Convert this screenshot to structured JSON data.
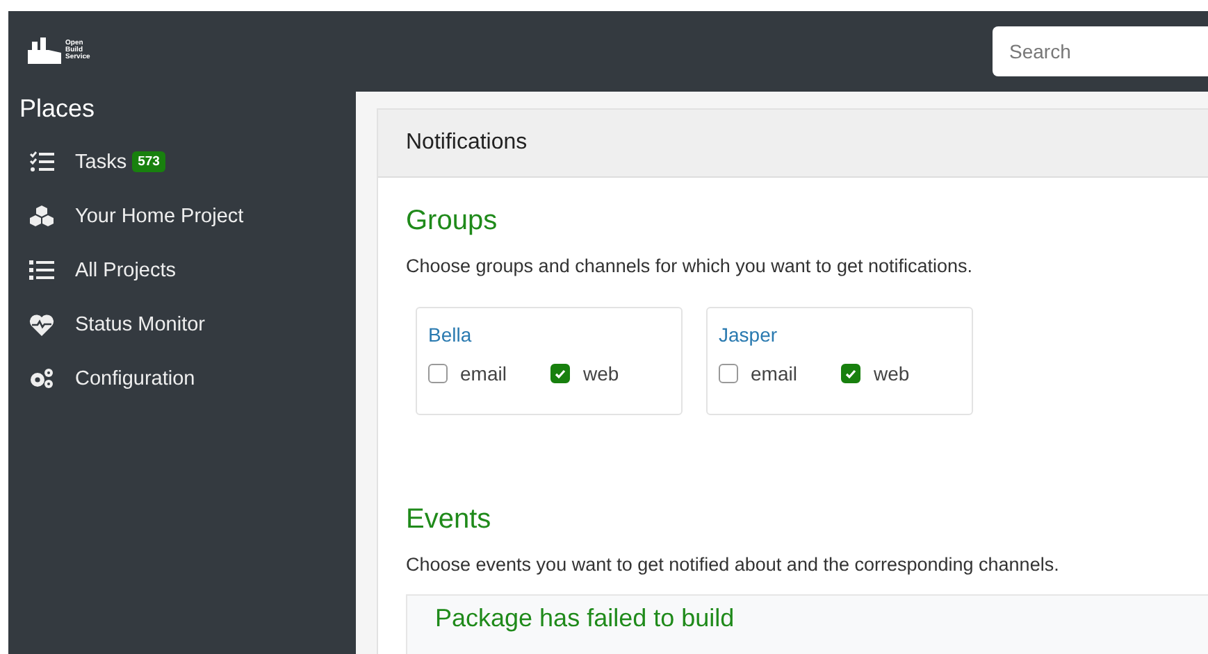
{
  "logo": {
    "text": "Open Build Service"
  },
  "sidebar": {
    "title": "Places",
    "items": [
      {
        "label": "Tasks",
        "badge": "573"
      },
      {
        "label": "Your Home Project"
      },
      {
        "label": "All Projects"
      },
      {
        "label": "Status Monitor"
      },
      {
        "label": "Configuration"
      }
    ]
  },
  "search": {
    "placeholder": "Search"
  },
  "card": {
    "title": "Notifications"
  },
  "groups": {
    "heading": "Groups",
    "description": "Choose groups and channels for which you want to get notifications.",
    "items": [
      {
        "name": "Bella",
        "channels": [
          {
            "label": "email",
            "checked": false
          },
          {
            "label": "web",
            "checked": true
          }
        ]
      },
      {
        "name": "Jasper",
        "channels": [
          {
            "label": "email",
            "checked": false
          },
          {
            "label": "web",
            "checked": true
          }
        ]
      }
    ]
  },
  "events": {
    "heading": "Events",
    "description": "Choose events you want to get notified about and the corresponding channels.",
    "items": [
      {
        "title": "Package has failed to build"
      }
    ]
  }
}
